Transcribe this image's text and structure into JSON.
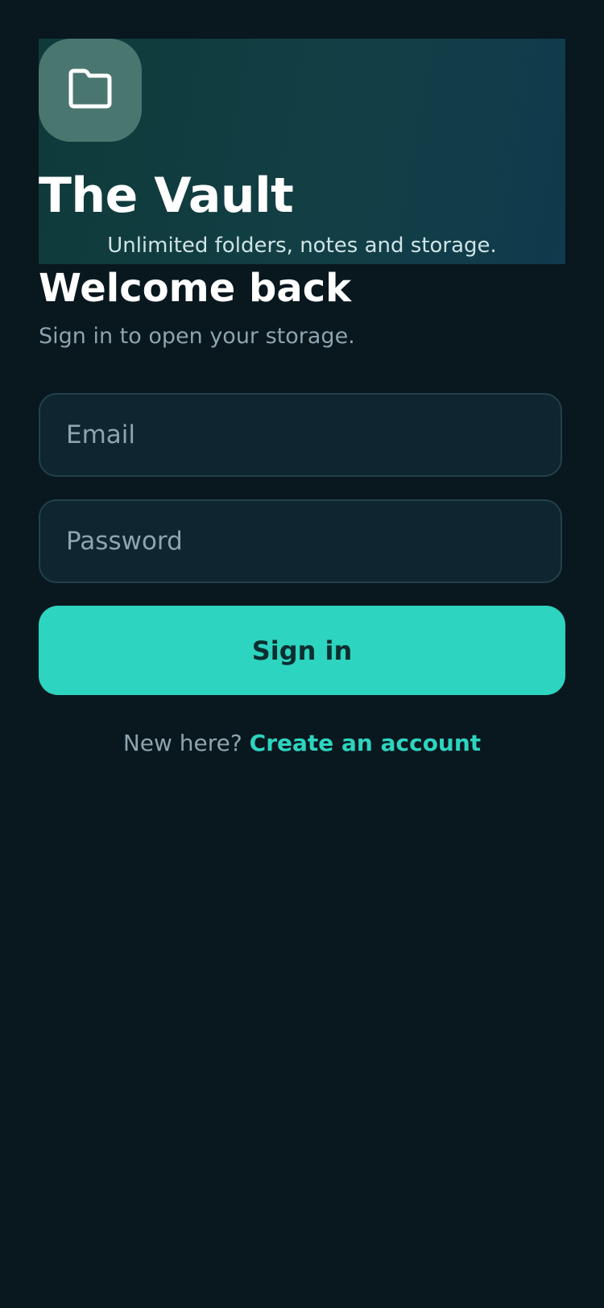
{
  "hero": {
    "icon": "folder-icon",
    "title": "The Vault",
    "subtitle": "Unlimited folders, notes and storage."
  },
  "welcome": {
    "title": "Welcome back",
    "subtitle": "Sign in to open your storage."
  },
  "form": {
    "email_placeholder": "Email",
    "password_placeholder": "Password",
    "signin_label": "Sign in"
  },
  "footer": {
    "prompt": "New here?",
    "link_label": "Create an account"
  },
  "colors": {
    "background": "#09171e",
    "accent": "#2dd4bf",
    "field_background": "#0f2530",
    "muted_text": "#8ea4ae"
  }
}
